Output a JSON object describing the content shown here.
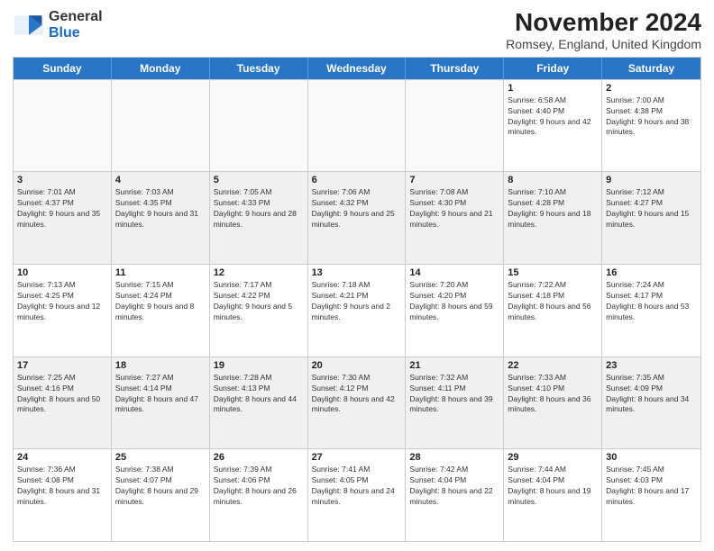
{
  "logo": {
    "general": "General",
    "blue": "Blue"
  },
  "header": {
    "month_year": "November 2024",
    "location": "Romsey, England, United Kingdom"
  },
  "weekdays": [
    "Sunday",
    "Monday",
    "Tuesday",
    "Wednesday",
    "Thursday",
    "Friday",
    "Saturday"
  ],
  "weeks": [
    [
      {
        "day": "",
        "info": ""
      },
      {
        "day": "",
        "info": ""
      },
      {
        "day": "",
        "info": ""
      },
      {
        "day": "",
        "info": ""
      },
      {
        "day": "",
        "info": ""
      },
      {
        "day": "1",
        "info": "Sunrise: 6:58 AM\nSunset: 4:40 PM\nDaylight: 9 hours and 42 minutes."
      },
      {
        "day": "2",
        "info": "Sunrise: 7:00 AM\nSunset: 4:38 PM\nDaylight: 9 hours and 38 minutes."
      }
    ],
    [
      {
        "day": "3",
        "info": "Sunrise: 7:01 AM\nSunset: 4:37 PM\nDaylight: 9 hours and 35 minutes."
      },
      {
        "day": "4",
        "info": "Sunrise: 7:03 AM\nSunset: 4:35 PM\nDaylight: 9 hours and 31 minutes."
      },
      {
        "day": "5",
        "info": "Sunrise: 7:05 AM\nSunset: 4:33 PM\nDaylight: 9 hours and 28 minutes."
      },
      {
        "day": "6",
        "info": "Sunrise: 7:06 AM\nSunset: 4:32 PM\nDaylight: 9 hours and 25 minutes."
      },
      {
        "day": "7",
        "info": "Sunrise: 7:08 AM\nSunset: 4:30 PM\nDaylight: 9 hours and 21 minutes."
      },
      {
        "day": "8",
        "info": "Sunrise: 7:10 AM\nSunset: 4:28 PM\nDaylight: 9 hours and 18 minutes."
      },
      {
        "day": "9",
        "info": "Sunrise: 7:12 AM\nSunset: 4:27 PM\nDaylight: 9 hours and 15 minutes."
      }
    ],
    [
      {
        "day": "10",
        "info": "Sunrise: 7:13 AM\nSunset: 4:25 PM\nDaylight: 9 hours and 12 minutes."
      },
      {
        "day": "11",
        "info": "Sunrise: 7:15 AM\nSunset: 4:24 PM\nDaylight: 9 hours and 8 minutes."
      },
      {
        "day": "12",
        "info": "Sunrise: 7:17 AM\nSunset: 4:22 PM\nDaylight: 9 hours and 5 minutes."
      },
      {
        "day": "13",
        "info": "Sunrise: 7:18 AM\nSunset: 4:21 PM\nDaylight: 9 hours and 2 minutes."
      },
      {
        "day": "14",
        "info": "Sunrise: 7:20 AM\nSunset: 4:20 PM\nDaylight: 8 hours and 59 minutes."
      },
      {
        "day": "15",
        "info": "Sunrise: 7:22 AM\nSunset: 4:18 PM\nDaylight: 8 hours and 56 minutes."
      },
      {
        "day": "16",
        "info": "Sunrise: 7:24 AM\nSunset: 4:17 PM\nDaylight: 8 hours and 53 minutes."
      }
    ],
    [
      {
        "day": "17",
        "info": "Sunrise: 7:25 AM\nSunset: 4:16 PM\nDaylight: 8 hours and 50 minutes."
      },
      {
        "day": "18",
        "info": "Sunrise: 7:27 AM\nSunset: 4:14 PM\nDaylight: 8 hours and 47 minutes."
      },
      {
        "day": "19",
        "info": "Sunrise: 7:28 AM\nSunset: 4:13 PM\nDaylight: 8 hours and 44 minutes."
      },
      {
        "day": "20",
        "info": "Sunrise: 7:30 AM\nSunset: 4:12 PM\nDaylight: 8 hours and 42 minutes."
      },
      {
        "day": "21",
        "info": "Sunrise: 7:32 AM\nSunset: 4:11 PM\nDaylight: 8 hours and 39 minutes."
      },
      {
        "day": "22",
        "info": "Sunrise: 7:33 AM\nSunset: 4:10 PM\nDaylight: 8 hours and 36 minutes."
      },
      {
        "day": "23",
        "info": "Sunrise: 7:35 AM\nSunset: 4:09 PM\nDaylight: 8 hours and 34 minutes."
      }
    ],
    [
      {
        "day": "24",
        "info": "Sunrise: 7:36 AM\nSunset: 4:08 PM\nDaylight: 8 hours and 31 minutes."
      },
      {
        "day": "25",
        "info": "Sunrise: 7:38 AM\nSunset: 4:07 PM\nDaylight: 8 hours and 29 minutes."
      },
      {
        "day": "26",
        "info": "Sunrise: 7:39 AM\nSunset: 4:06 PM\nDaylight: 8 hours and 26 minutes."
      },
      {
        "day": "27",
        "info": "Sunrise: 7:41 AM\nSunset: 4:05 PM\nDaylight: 8 hours and 24 minutes."
      },
      {
        "day": "28",
        "info": "Sunrise: 7:42 AM\nSunset: 4:04 PM\nDaylight: 8 hours and 22 minutes."
      },
      {
        "day": "29",
        "info": "Sunrise: 7:44 AM\nSunset: 4:04 PM\nDaylight: 8 hours and 19 minutes."
      },
      {
        "day": "30",
        "info": "Sunrise: 7:45 AM\nSunset: 4:03 PM\nDaylight: 8 hours and 17 minutes."
      }
    ]
  ]
}
